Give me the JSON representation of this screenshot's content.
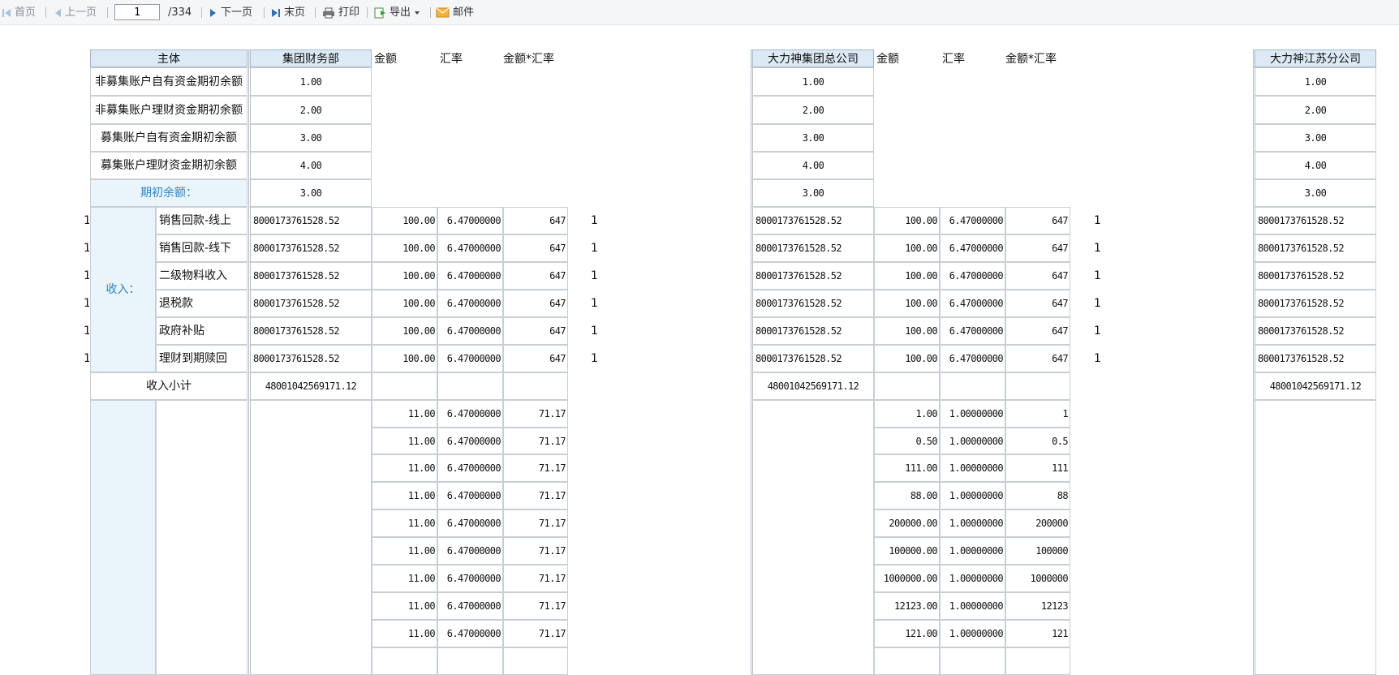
{
  "toolbar": {
    "first": "首页",
    "prev": "上一页",
    "page": "1",
    "total": "/334",
    "next": "下一页",
    "last": "末页",
    "print": "打印",
    "export": "导出",
    "mail": "邮件"
  },
  "colors": {
    "header_bg": "#dceaf6",
    "label_blue": "#2a86c8",
    "label_bg": "#e9f4fb",
    "grid": "#c9ced4"
  },
  "table": {
    "subject_header": "主体",
    "col_amount": "金额",
    "col_rate": "汇率",
    "col_product": "金额*汇率",
    "entities": [
      "集团财务部",
      "大力神集团总公司",
      "大力神江苏分公司"
    ],
    "opening_rows": [
      {
        "label": "非募集账户自有资金期初余额",
        "values": [
          "1.00",
          "1.00",
          "1.00"
        ]
      },
      {
        "label": "非募集账户理财资金期初余额",
        "values": [
          "2.00",
          "2.00",
          "2.00"
        ]
      },
      {
        "label": "募集账户自有资金期初余额",
        "values": [
          "3.00",
          "3.00",
          "3.00"
        ]
      },
      {
        "label": "募集账户理财资金期初余额",
        "values": [
          "4.00",
          "4.00",
          "4.00"
        ]
      }
    ],
    "opening_total": {
      "label": "期初余额：",
      "values": [
        "3.00",
        "3.00",
        "3.00"
      ]
    },
    "income_group": "收入：",
    "income_rows": [
      {
        "label": "销售回款-线上"
      },
      {
        "label": "销售回款-线下"
      },
      {
        "label": "二级物料收入"
      },
      {
        "label": "退税款"
      },
      {
        "label": "政府补贴"
      },
      {
        "label": "理财到期赎回"
      }
    ],
    "income_values": {
      "left_marker": "1",
      "value": "8000173761528.52",
      "amount": "100.00",
      "rate": "6.47000000",
      "product": "647",
      "count": "1"
    },
    "income_subtotal": {
      "label": "收入小计",
      "value": "48001042569171.12"
    },
    "expense_rows_e1": [
      {
        "amount": "11.00",
        "rate": "6.47000000",
        "product": "71.17"
      },
      {
        "amount": "11.00",
        "rate": "6.47000000",
        "product": "71.17"
      },
      {
        "amount": "11.00",
        "rate": "6.47000000",
        "product": "71.17"
      },
      {
        "amount": "11.00",
        "rate": "6.47000000",
        "product": "71.17"
      },
      {
        "amount": "11.00",
        "rate": "6.47000000",
        "product": "71.17"
      },
      {
        "amount": "11.00",
        "rate": "6.47000000",
        "product": "71.17"
      },
      {
        "amount": "11.00",
        "rate": "6.47000000",
        "product": "71.17"
      },
      {
        "amount": "11.00",
        "rate": "6.47000000",
        "product": "71.17"
      },
      {
        "amount": "11.00",
        "rate": "6.47000000",
        "product": "71.17"
      }
    ],
    "expense_rows_e2": [
      {
        "amount": "1.00",
        "rate": "1.00000000",
        "product": "1"
      },
      {
        "amount": "0.50",
        "rate": "1.00000000",
        "product": "0.5"
      },
      {
        "amount": "111.00",
        "rate": "1.00000000",
        "product": "111"
      },
      {
        "amount": "88.00",
        "rate": "1.00000000",
        "product": "88"
      },
      {
        "amount": "200000.00",
        "rate": "1.00000000",
        "product": "200000"
      },
      {
        "amount": "100000.00",
        "rate": "1.00000000",
        "product": "100000"
      },
      {
        "amount": "1000000.00",
        "rate": "1.00000000",
        "product": "1000000"
      },
      {
        "amount": "12123.00",
        "rate": "1.00000000",
        "product": "12123"
      },
      {
        "amount": "121.00",
        "rate": "1.00000000",
        "product": "121"
      }
    ]
  }
}
